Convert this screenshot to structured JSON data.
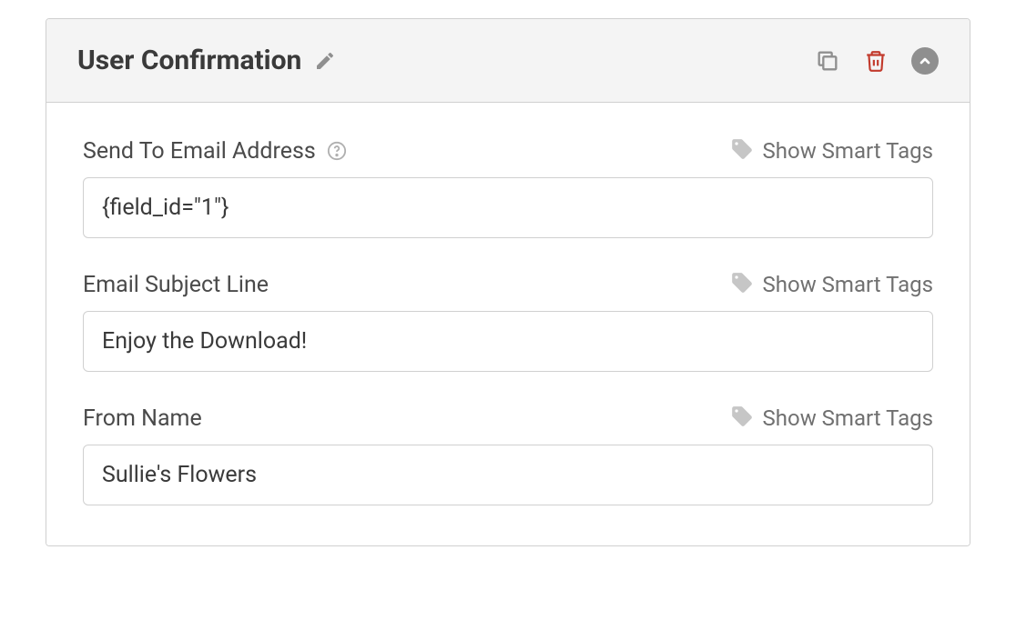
{
  "header": {
    "title": "User Confirmation"
  },
  "smart_tags_label": "Show Smart Tags",
  "fields": {
    "send_to": {
      "label": "Send To Email Address",
      "value": "{field_id=\"1\"}"
    },
    "subject": {
      "label": "Email Subject Line",
      "value": "Enjoy the Download!"
    },
    "from_name": {
      "label": "From Name",
      "value": "Sullie's Flowers"
    }
  }
}
